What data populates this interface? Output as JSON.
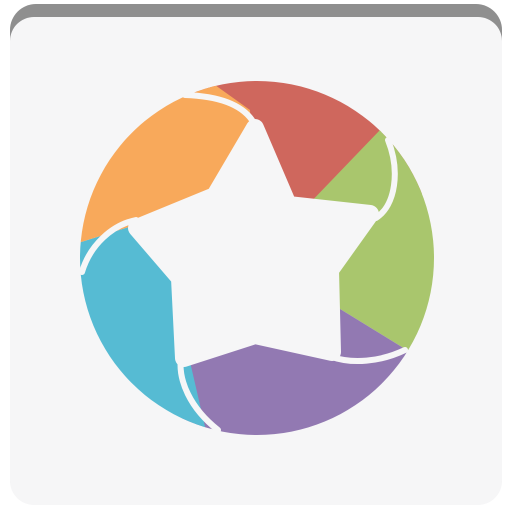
{
  "app_icon": {
    "icon": "rainbow-star-swirl-icon",
    "colors": {
      "tile_background": "#f6f6f7",
      "tile_shadow": "#8f8f8f",
      "star_fill": "#f6f6f7",
      "petal_red": "#cf675d",
      "petal_green": "#a9c66d",
      "petal_purple": "#9279b2",
      "petal_blue": "#56bbd3",
      "petal_orange": "#f8a95b"
    }
  }
}
